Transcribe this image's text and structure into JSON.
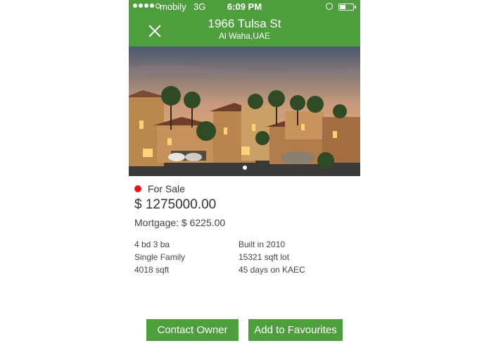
{
  "status_bar": {
    "carrier": "mobily",
    "network": "3G",
    "time": "6:09 PM"
  },
  "header": {
    "title": "1966 Tulsa St",
    "subtitle": "Al Waha,UAE",
    "close_icon": "close-icon"
  },
  "listing": {
    "status": "For Sale",
    "status_color": "#e8141b",
    "price": "$ 1275000.00",
    "mortgage": "Mortgage: $ 6225.00",
    "facts_left": [
      "4 bd 3 ba",
      "Single Family",
      "4018 sqft"
    ],
    "facts_right": [
      "Built in 2010",
      "15321 sqft lot",
      "45 days on KAEC"
    ]
  },
  "actions": {
    "contact": "Contact Owner",
    "favourites": "Add to Favourites"
  },
  "colors": {
    "accent": "#4e9e3e"
  }
}
